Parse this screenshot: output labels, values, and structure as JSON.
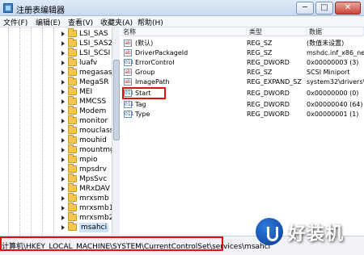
{
  "window": {
    "title": "注册表编辑器",
    "minimize_label": "─",
    "maximize_label": "□",
    "close_label": "✕"
  },
  "menu": [
    "文件(F)",
    "编辑(E)",
    "查看(V)",
    "收藏夹(A)",
    "帮助(H)"
  ],
  "tree": {
    "items": [
      "LSI_SAS",
      "LSI_SAS2",
      "LSI_SCSI",
      "luafv",
      "megasas",
      "MegaSR",
      "MEI",
      "MMCSS",
      "Modem",
      "monitor",
      "mouclass",
      "mouhid",
      "mountmgr",
      "mpio",
      "mpsdrv",
      "MpsSvc",
      "MRxDAV",
      "mrxsmb",
      "mrxsmb10",
      "mrxsmb20",
      "msahci"
    ],
    "selected": "msahci"
  },
  "columns": {
    "name": "名称",
    "type": "类型",
    "data": "数据"
  },
  "values": [
    {
      "icon": "ab",
      "name": "(默认)",
      "type": "REG_SZ",
      "data": "(数值未设置)"
    },
    {
      "icon": "ab",
      "name": "DriverPackageId",
      "type": "REG_SZ",
      "data": "mshdc.inf_x86_neut"
    },
    {
      "icon": "011",
      "name": "ErrorControl",
      "type": "REG_DWORD",
      "data": "0x00000003 (3)"
    },
    {
      "icon": "ab",
      "name": "Group",
      "type": "REG_SZ",
      "data": "SCSI Miniport"
    },
    {
      "icon": "ab",
      "name": "ImagePath",
      "type": "REG_EXPAND_SZ",
      "data": "system32\\drivers\\m"
    },
    {
      "icon": "011",
      "name": "Start",
      "type": "REG_DWORD",
      "data": "0x00000000 (0)"
    },
    {
      "icon": "011",
      "name": "Tag",
      "type": "REG_DWORD",
      "data": "0x00000040 (64)"
    },
    {
      "icon": "011",
      "name": "Type",
      "type": "REG_DWORD",
      "data": "0x00000001 (1)"
    }
  ],
  "status": {
    "path": "计算机\\HKEY_LOCAL_MACHINE\\SYSTEM\\CurrentControlSet\\services\\msahci"
  },
  "watermark": {
    "text": "好装机"
  },
  "colors": {
    "highlight_border": "#e01010",
    "selection": "#cfe3fb"
  }
}
